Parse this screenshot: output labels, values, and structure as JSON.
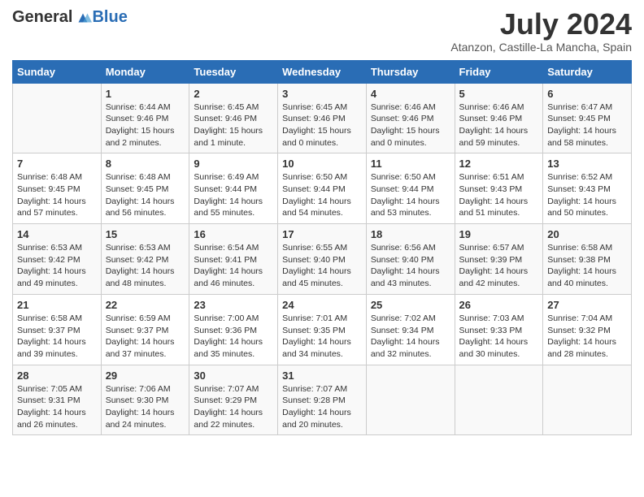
{
  "logo": {
    "general": "General",
    "blue": "Blue"
  },
  "title": "July 2024",
  "subtitle": "Atanzon, Castille-La Mancha, Spain",
  "weekdays": [
    "Sunday",
    "Monday",
    "Tuesday",
    "Wednesday",
    "Thursday",
    "Friday",
    "Saturday"
  ],
  "weeks": [
    [
      {
        "day": "",
        "sunrise": "",
        "sunset": "",
        "daylight": ""
      },
      {
        "day": "1",
        "sunrise": "Sunrise: 6:44 AM",
        "sunset": "Sunset: 9:46 PM",
        "daylight": "Daylight: 15 hours and 2 minutes."
      },
      {
        "day": "2",
        "sunrise": "Sunrise: 6:45 AM",
        "sunset": "Sunset: 9:46 PM",
        "daylight": "Daylight: 15 hours and 1 minute."
      },
      {
        "day": "3",
        "sunrise": "Sunrise: 6:45 AM",
        "sunset": "Sunset: 9:46 PM",
        "daylight": "Daylight: 15 hours and 0 minutes."
      },
      {
        "day": "4",
        "sunrise": "Sunrise: 6:46 AM",
        "sunset": "Sunset: 9:46 PM",
        "daylight": "Daylight: 15 hours and 0 minutes."
      },
      {
        "day": "5",
        "sunrise": "Sunrise: 6:46 AM",
        "sunset": "Sunset: 9:46 PM",
        "daylight": "Daylight: 14 hours and 59 minutes."
      },
      {
        "day": "6",
        "sunrise": "Sunrise: 6:47 AM",
        "sunset": "Sunset: 9:45 PM",
        "daylight": "Daylight: 14 hours and 58 minutes."
      }
    ],
    [
      {
        "day": "7",
        "sunrise": "Sunrise: 6:48 AM",
        "sunset": "Sunset: 9:45 PM",
        "daylight": "Daylight: 14 hours and 57 minutes."
      },
      {
        "day": "8",
        "sunrise": "Sunrise: 6:48 AM",
        "sunset": "Sunset: 9:45 PM",
        "daylight": "Daylight: 14 hours and 56 minutes."
      },
      {
        "day": "9",
        "sunrise": "Sunrise: 6:49 AM",
        "sunset": "Sunset: 9:44 PM",
        "daylight": "Daylight: 14 hours and 55 minutes."
      },
      {
        "day": "10",
        "sunrise": "Sunrise: 6:50 AM",
        "sunset": "Sunset: 9:44 PM",
        "daylight": "Daylight: 14 hours and 54 minutes."
      },
      {
        "day": "11",
        "sunrise": "Sunrise: 6:50 AM",
        "sunset": "Sunset: 9:44 PM",
        "daylight": "Daylight: 14 hours and 53 minutes."
      },
      {
        "day": "12",
        "sunrise": "Sunrise: 6:51 AM",
        "sunset": "Sunset: 9:43 PM",
        "daylight": "Daylight: 14 hours and 51 minutes."
      },
      {
        "day": "13",
        "sunrise": "Sunrise: 6:52 AM",
        "sunset": "Sunset: 9:43 PM",
        "daylight": "Daylight: 14 hours and 50 minutes."
      }
    ],
    [
      {
        "day": "14",
        "sunrise": "Sunrise: 6:53 AM",
        "sunset": "Sunset: 9:42 PM",
        "daylight": "Daylight: 14 hours and 49 minutes."
      },
      {
        "day": "15",
        "sunrise": "Sunrise: 6:53 AM",
        "sunset": "Sunset: 9:42 PM",
        "daylight": "Daylight: 14 hours and 48 minutes."
      },
      {
        "day": "16",
        "sunrise": "Sunrise: 6:54 AM",
        "sunset": "Sunset: 9:41 PM",
        "daylight": "Daylight: 14 hours and 46 minutes."
      },
      {
        "day": "17",
        "sunrise": "Sunrise: 6:55 AM",
        "sunset": "Sunset: 9:40 PM",
        "daylight": "Daylight: 14 hours and 45 minutes."
      },
      {
        "day": "18",
        "sunrise": "Sunrise: 6:56 AM",
        "sunset": "Sunset: 9:40 PM",
        "daylight": "Daylight: 14 hours and 43 minutes."
      },
      {
        "day": "19",
        "sunrise": "Sunrise: 6:57 AM",
        "sunset": "Sunset: 9:39 PM",
        "daylight": "Daylight: 14 hours and 42 minutes."
      },
      {
        "day": "20",
        "sunrise": "Sunrise: 6:58 AM",
        "sunset": "Sunset: 9:38 PM",
        "daylight": "Daylight: 14 hours and 40 minutes."
      }
    ],
    [
      {
        "day": "21",
        "sunrise": "Sunrise: 6:58 AM",
        "sunset": "Sunset: 9:37 PM",
        "daylight": "Daylight: 14 hours and 39 minutes."
      },
      {
        "day": "22",
        "sunrise": "Sunrise: 6:59 AM",
        "sunset": "Sunset: 9:37 PM",
        "daylight": "Daylight: 14 hours and 37 minutes."
      },
      {
        "day": "23",
        "sunrise": "Sunrise: 7:00 AM",
        "sunset": "Sunset: 9:36 PM",
        "daylight": "Daylight: 14 hours and 35 minutes."
      },
      {
        "day": "24",
        "sunrise": "Sunrise: 7:01 AM",
        "sunset": "Sunset: 9:35 PM",
        "daylight": "Daylight: 14 hours and 34 minutes."
      },
      {
        "day": "25",
        "sunrise": "Sunrise: 7:02 AM",
        "sunset": "Sunset: 9:34 PM",
        "daylight": "Daylight: 14 hours and 32 minutes."
      },
      {
        "day": "26",
        "sunrise": "Sunrise: 7:03 AM",
        "sunset": "Sunset: 9:33 PM",
        "daylight": "Daylight: 14 hours and 30 minutes."
      },
      {
        "day": "27",
        "sunrise": "Sunrise: 7:04 AM",
        "sunset": "Sunset: 9:32 PM",
        "daylight": "Daylight: 14 hours and 28 minutes."
      }
    ],
    [
      {
        "day": "28",
        "sunrise": "Sunrise: 7:05 AM",
        "sunset": "Sunset: 9:31 PM",
        "daylight": "Daylight: 14 hours and 26 minutes."
      },
      {
        "day": "29",
        "sunrise": "Sunrise: 7:06 AM",
        "sunset": "Sunset: 9:30 PM",
        "daylight": "Daylight: 14 hours and 24 minutes."
      },
      {
        "day": "30",
        "sunrise": "Sunrise: 7:07 AM",
        "sunset": "Sunset: 9:29 PM",
        "daylight": "Daylight: 14 hours and 22 minutes."
      },
      {
        "day": "31",
        "sunrise": "Sunrise: 7:07 AM",
        "sunset": "Sunset: 9:28 PM",
        "daylight": "Daylight: 14 hours and 20 minutes."
      },
      {
        "day": "",
        "sunrise": "",
        "sunset": "",
        "daylight": ""
      },
      {
        "day": "",
        "sunrise": "",
        "sunset": "",
        "daylight": ""
      },
      {
        "day": "",
        "sunrise": "",
        "sunset": "",
        "daylight": ""
      }
    ]
  ]
}
